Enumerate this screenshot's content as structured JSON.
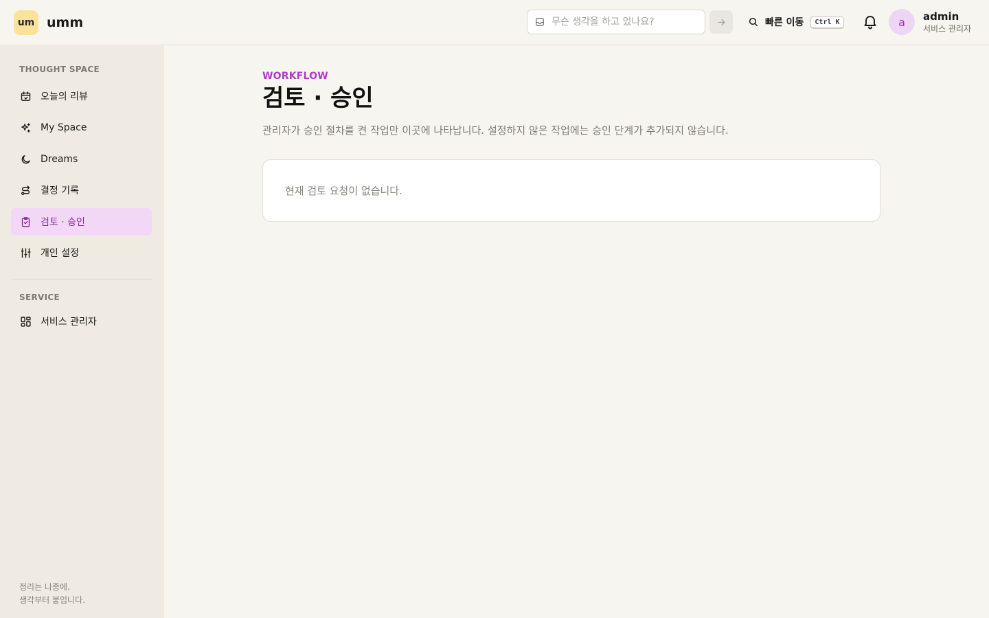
{
  "app": {
    "logo_text": "um",
    "name": "umm"
  },
  "header": {
    "quick_input_placeholder": "무슨 생각을 하고 있나요?",
    "quick_nav_label": "빠른 이동",
    "shortcut": "Ctrl K",
    "user": {
      "avatar_letter": "a",
      "name": "admin",
      "role": "서비스 관리자"
    }
  },
  "sidebar": {
    "section_thought": "THOUGHT SPACE",
    "items": [
      {
        "label": "오늘의 리뷰",
        "icon": "calendar-check-icon"
      },
      {
        "label": "My Space",
        "icon": "sparkles-icon"
      },
      {
        "label": "Dreams",
        "icon": "moon-icon"
      },
      {
        "label": "결정 기록",
        "icon": "route-icon"
      },
      {
        "label": "검토 · 승인",
        "icon": "clipboard-check-icon",
        "active": true
      },
      {
        "label": "개인 설정",
        "icon": "sliders-icon"
      }
    ],
    "section_service": "SERVICE",
    "service_items": [
      {
        "label": "서비스 관리자",
        "icon": "grid-icon"
      }
    ],
    "footer_line1": "정리는 나중에.",
    "footer_line2": "생각부터 붙입니다."
  },
  "main": {
    "eyebrow": "WORKFLOW",
    "title": "검토 · 승인",
    "description": "관리자가 승인 절차를 켠 작업만 이곳에 나타납니다. 설정하지 않은 작업에는 승인 단계가 추가되지 않습니다.",
    "empty_message": "현재 검토 요청이 없습니다."
  },
  "colors": {
    "accent": "#b238c9",
    "active_bg": "#f2d8f6",
    "logo_bg": "#fbe29a",
    "page_bg": "#f7f5f0",
    "sidebar_bg": "#efebe2"
  }
}
